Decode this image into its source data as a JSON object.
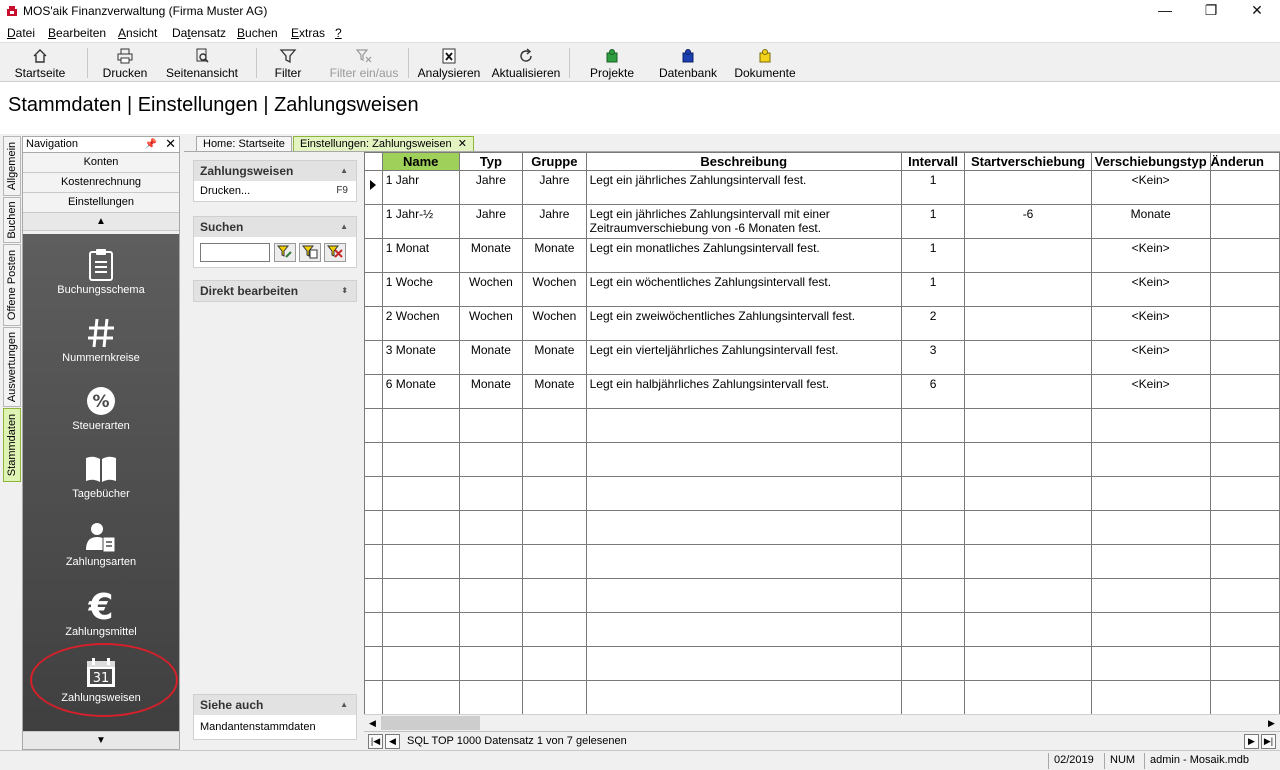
{
  "window": {
    "title": "MOS'aik Finanzverwaltung (Firma Muster AG)",
    "controls": [
      "—",
      "❐",
      "✕"
    ]
  },
  "menu": {
    "items": [
      {
        "label": "Datei",
        "u": "D",
        "rest": "atei"
      },
      {
        "label": "Bearbeiten",
        "u": "B",
        "rest": "earbeiten"
      },
      {
        "label": "Ansicht",
        "u": "A",
        "rest": "nsicht"
      },
      {
        "label": "Datensatz",
        "pre": "Da",
        "u": "t",
        "rest": "ensatz"
      },
      {
        "label": "Buchen",
        "u": "B",
        "rest": "uchen"
      },
      {
        "label": "Extras",
        "u": "E",
        "rest": "xtras"
      },
      {
        "label": "?",
        "u": "?",
        "rest": ""
      }
    ]
  },
  "toolbar": {
    "startseite": "Startseite",
    "drucken": "Drucken",
    "seitenansicht": "Seitenansicht",
    "filter": "Filter",
    "filter_ein_aus": "Filter ein/aus",
    "analysieren": "Analysieren",
    "aktualisieren": "Aktualisieren",
    "projekte": "Projekte",
    "datenbank": "Datenbank",
    "dokumente": "Dokumente"
  },
  "page": {
    "title": "Stammdaten | Einstellungen | Zahlungsweisen"
  },
  "side_tabs": [
    "Allgemein",
    "Buchen",
    "Offene Posten",
    "Auswertungen",
    "Stammdaten"
  ],
  "navigation": {
    "header": "Navigation",
    "sections": [
      "Konten",
      "Kostenrechnung",
      "Einstellungen"
    ],
    "items": [
      "Buchungsschema",
      "Nummernkreise",
      "Steuerarten",
      "Tagebücher",
      "Zahlungsarten",
      "Zahlungsmittel",
      "Zahlungsweisen"
    ],
    "calendar_day": "31"
  },
  "doc_tabs": {
    "home": "Home: Startseite",
    "active": "Einstellungen: Zahlungsweisen",
    "close": "✕"
  },
  "taskpane": {
    "zahlungsweisen": {
      "title": "Zahlungsweisen",
      "drucken": "Drucken...",
      "shortcut": "F9"
    },
    "suchen": {
      "title": "Suchen",
      "value": ""
    },
    "direkt": {
      "title": "Direkt bearbeiten"
    },
    "siehe_auch": {
      "title": "Siehe auch",
      "link": "Mandantenstammdaten"
    }
  },
  "grid": {
    "columns": [
      "Name",
      "Typ",
      "Gruppe",
      "Beschreibung",
      "Intervall",
      "Startverschiebung",
      "Verschiebungstyp",
      "Änderun"
    ],
    "sorted_column": "Name",
    "rows": [
      {
        "name": "1 Jahr",
        "typ": "Jahre",
        "gruppe": "Jahre",
        "beschreibung": "Legt ein jährliches Zahlungsintervall fest.",
        "intervall": "1",
        "start": "",
        "vtyp": "<Kein>",
        "aenderung": ""
      },
      {
        "name": "1 Jahr-½",
        "typ": "Jahre",
        "gruppe": "Jahre",
        "beschreibung": "Legt ein jährliches Zahlungsintervall mit einer Zeitraumverschiebung von -6 Monaten fest.",
        "intervall": "1",
        "start": "-6",
        "vtyp": "Monate",
        "aenderung": ""
      },
      {
        "name": "1 Monat",
        "typ": "Monate",
        "gruppe": "Monate",
        "beschreibung": "Legt ein monatliches Zahlungsintervall fest.",
        "intervall": "1",
        "start": "",
        "vtyp": "<Kein>",
        "aenderung": ""
      },
      {
        "name": "1 Woche",
        "typ": "Wochen",
        "gruppe": "Wochen",
        "beschreibung": "Legt ein wöchentliches Zahlungsintervall fest.",
        "intervall": "1",
        "start": "",
        "vtyp": "<Kein>",
        "aenderung": ""
      },
      {
        "name": "2 Wochen",
        "typ": "Wochen",
        "gruppe": "Wochen",
        "beschreibung": "Legt ein zweiwöchentliches Zahlungsintervall fest.",
        "intervall": "2",
        "start": "",
        "vtyp": "<Kein>",
        "aenderung": ""
      },
      {
        "name": "3 Monate",
        "typ": "Monate",
        "gruppe": "Monate",
        "beschreibung": "Legt ein vierteljährliches Zahlungsintervall fest.",
        "intervall": "3",
        "start": "",
        "vtyp": "<Kein>",
        "aenderung": ""
      },
      {
        "name": "6 Monate",
        "typ": "Monate",
        "gruppe": "Monate",
        "beschreibung": "Legt ein halbjährliches Zahlungsintervall fest.",
        "intervall": "6",
        "start": "",
        "vtyp": "<Kein>",
        "aenderung": ""
      }
    ],
    "empty_rows": 9
  },
  "record_nav": {
    "text": "SQL TOP 1000 Datensatz 1 von 7 gelesenen"
  },
  "status": {
    "period": "02/2019",
    "num": "NUM",
    "user_db": "admin - Mosaik.mdb"
  },
  "colors": {
    "accent_green": "#9fd15a",
    "tab_active": "#e3f4c2",
    "nav_dark": "#4e4e4e",
    "highlight_red": "#d6202a"
  }
}
